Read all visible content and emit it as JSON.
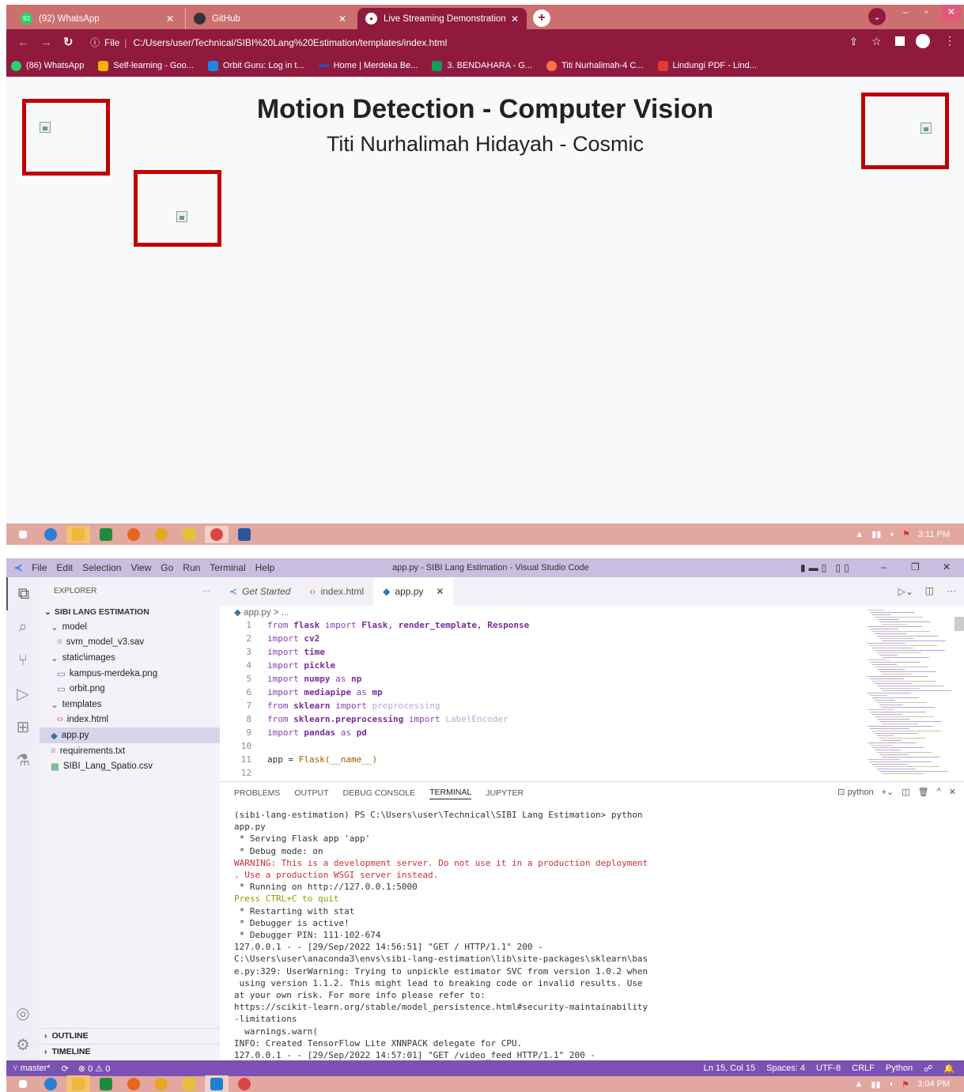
{
  "browser": {
    "tabs": [
      {
        "label": "(92) WhatsApp",
        "badge": "92",
        "color": "#25d366"
      },
      {
        "label": "GitHub",
        "color": "#333333"
      },
      {
        "label": "Live Streaming Demonstration",
        "color": "#ffffff"
      }
    ],
    "file_label": "File",
    "url": "C:/Users/user/Technical/SIBI%20Lang%20Estimation/templates/index.html",
    "bookmarks": [
      {
        "label": "(86) WhatsApp",
        "color": "#25d366"
      },
      {
        "label": "Self-learning - Goo...",
        "color": "#f4b400"
      },
      {
        "label": "Orbit Guru: Log in t...",
        "color": "#1e88e5"
      },
      {
        "label": "Home | Merdeka Be...",
        "color": "#3949ab"
      },
      {
        "label": "3. BENDAHARA - G...",
        "color": "#0f9d58"
      },
      {
        "label": "Titi Nurhalimah-4 C...",
        "color": "#ff7043"
      },
      {
        "label": "Lindungi PDF - Lind...",
        "color": "#e53935"
      }
    ]
  },
  "page": {
    "title": "Motion Detection - Computer Vision",
    "subtitle": "Titi Nurhalimah Hidayah - Cosmic",
    "box_color": "#c00000"
  },
  "taskbar_top": {
    "time": "3:11 PM"
  },
  "vscode": {
    "menu": [
      "File",
      "Edit",
      "Selection",
      "View",
      "Go",
      "Run",
      "Terminal",
      "Help"
    ],
    "window_title": "app.py - SIBI Lang Estimation - Visual Studio Code",
    "explorer_label": "EXPLORER",
    "project": "SIBI LANG ESTIMATION",
    "tree": [
      {
        "label": "model",
        "indent": 1,
        "kind": "folder"
      },
      {
        "label": "svm_model_v3.sav",
        "indent": 2,
        "kind": "file"
      },
      {
        "label": "static\\images",
        "indent": 1,
        "kind": "folder"
      },
      {
        "label": "kampus-merdeka.png",
        "indent": 2,
        "kind": "img"
      },
      {
        "label": "orbit.png",
        "indent": 2,
        "kind": "img"
      },
      {
        "label": "templates",
        "indent": 1,
        "kind": "folder"
      },
      {
        "label": "index.html",
        "indent": 2,
        "kind": "html"
      },
      {
        "label": "app.py",
        "indent": 1,
        "kind": "py",
        "selected": true
      },
      {
        "label": "requirements.txt",
        "indent": 1,
        "kind": "file"
      },
      {
        "label": "SIBI_Lang_Spatio.csv",
        "indent": 1,
        "kind": "csv"
      }
    ],
    "outline": "OUTLINE",
    "timeline": "TIMELINE",
    "tabs": [
      {
        "label": "Get Started"
      },
      {
        "label": "index.html"
      },
      {
        "label": "app.py"
      }
    ],
    "breadcrumb": "app.py > ...",
    "code": [
      "from flask import Flask, render_template, Response",
      "import cv2",
      "import time",
      "import pickle",
      "import numpy as np",
      "import mediapipe as mp",
      "from sklearn import preprocessing",
      "from sklearn.preprocessing import LabelEncoder",
      "import pandas as pd",
      "",
      "app = Flask(__name__)",
      ""
    ],
    "panel_tabs": [
      "PROBLEMS",
      "OUTPUT",
      "DEBUG CONSOLE",
      "TERMINAL",
      "JUPYTER"
    ],
    "terminal_name": "python",
    "terminal": [
      {
        "t": "(sibi-lang-estimation) PS C:\\Users\\user\\Technical\\SIBI Lang Estimation> python",
        "c": "#333333"
      },
      {
        "t": "app.py",
        "c": "#333333"
      },
      {
        "t": " * Serving Flask app 'app'",
        "c": "#333333"
      },
      {
        "t": " * Debug mode: on",
        "c": "#333333"
      },
      {
        "t": "WARNING: This is a development server. Do not use it in a production deployment",
        "c": "#cd3131"
      },
      {
        "t": ". Use a production WSGI server instead.",
        "c": "#cd3131"
      },
      {
        "t": " * Running on http://127.0.0.1:5000",
        "c": "#333333"
      },
      {
        "t": "Press CTRL+C to quit",
        "c": "#949800"
      },
      {
        "t": " * Restarting with stat",
        "c": "#333333"
      },
      {
        "t": " * Debugger is active!",
        "c": "#333333"
      },
      {
        "t": " * Debugger PIN: 111-102-674",
        "c": "#333333"
      },
      {
        "t": "127.0.0.1 - - [29/Sep/2022 14:56:51] \"GET / HTTP/1.1\" 200 -",
        "c": "#333333"
      },
      {
        "t": "C:\\Users\\user\\anaconda3\\envs\\sibi-lang-estimation\\lib\\site-packages\\sklearn\\bas",
        "c": "#333333"
      },
      {
        "t": "e.py:329: UserWarning: Trying to unpickle estimator SVC from version 1.0.2 when",
        "c": "#333333"
      },
      {
        "t": " using version 1.1.2. This might lead to breaking code or invalid results. Use",
        "c": "#333333"
      },
      {
        "t": "at your own risk. For more info please refer to:",
        "c": "#333333"
      },
      {
        "t": "https://scikit-learn.org/stable/model_persistence.html#security-maintainability",
        "c": "#333333"
      },
      {
        "t": "-limitations",
        "c": "#333333"
      },
      {
        "t": "  warnings.warn(",
        "c": "#333333"
      },
      {
        "t": "INFO: Created TensorFlow Lite XNNPACK delegate for CPU.",
        "c": "#333333"
      },
      {
        "t": "127.0.0.1 - - [29/Sep/2022 14:57:01] \"GET /video_feed HTTP/1.1\" 200 -",
        "c": "#333333"
      }
    ],
    "status": {
      "branch": "master*",
      "problems": "0",
      "warnings": "0",
      "position": "Ln 15, Col 15",
      "spaces": "Spaces: 4",
      "encoding": "UTF-8",
      "eol": "CRLF",
      "language": "Python"
    }
  },
  "taskbar_bottom": {
    "time": "3:04 PM"
  }
}
